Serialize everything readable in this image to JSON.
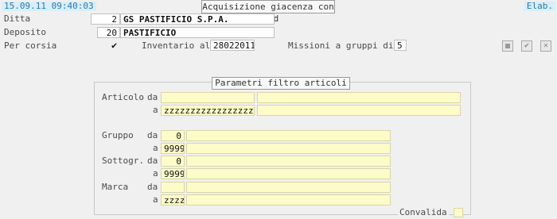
{
  "header": {
    "datetime": "15.09.11 09:40:03",
    "title": "Acquisizione giacenza con RMHd",
    "status": "Elab."
  },
  "form": {
    "ditta": {
      "label": "Ditta",
      "code": "2",
      "name": "GS PASTIFICIO S.P.A."
    },
    "deposito": {
      "label": "Deposito",
      "code": "20",
      "name": "PASTIFICIO"
    },
    "per_corsia": {
      "label": "Per corsia",
      "checked": "✔"
    },
    "inventario": {
      "label": "Inventario al",
      "value": "28022011"
    },
    "missioni": {
      "label": "Missioni a gruppi di",
      "value": "5"
    }
  },
  "toolbar": {
    "icons": [
      "save-icon",
      "confirm-icon",
      "cancel-icon"
    ],
    "confirm_glyph": "✔",
    "cancel_glyph": "✕"
  },
  "filter": {
    "title": "Parametri filtro articoli",
    "articolo": {
      "label": "Articolo",
      "da_label": "da",
      "a_label": "a",
      "da_value": "",
      "a_value": "zzzzzzzzzzzzzzzzzz"
    },
    "gruppo": {
      "label": "Gruppo",
      "da_label": "da",
      "a_label": "a",
      "da_value": "0",
      "a_value": "9999"
    },
    "sottogr": {
      "label": "Sottogr.",
      "da_label": "da",
      "a_label": "a",
      "da_value": "0",
      "a_value": "9999"
    },
    "marca": {
      "label": "Marca",
      "da_label": "da",
      "a_label": "a",
      "da_value": "",
      "a_value": "zzzz"
    },
    "convalida": {
      "label": "Convalida"
    }
  }
}
